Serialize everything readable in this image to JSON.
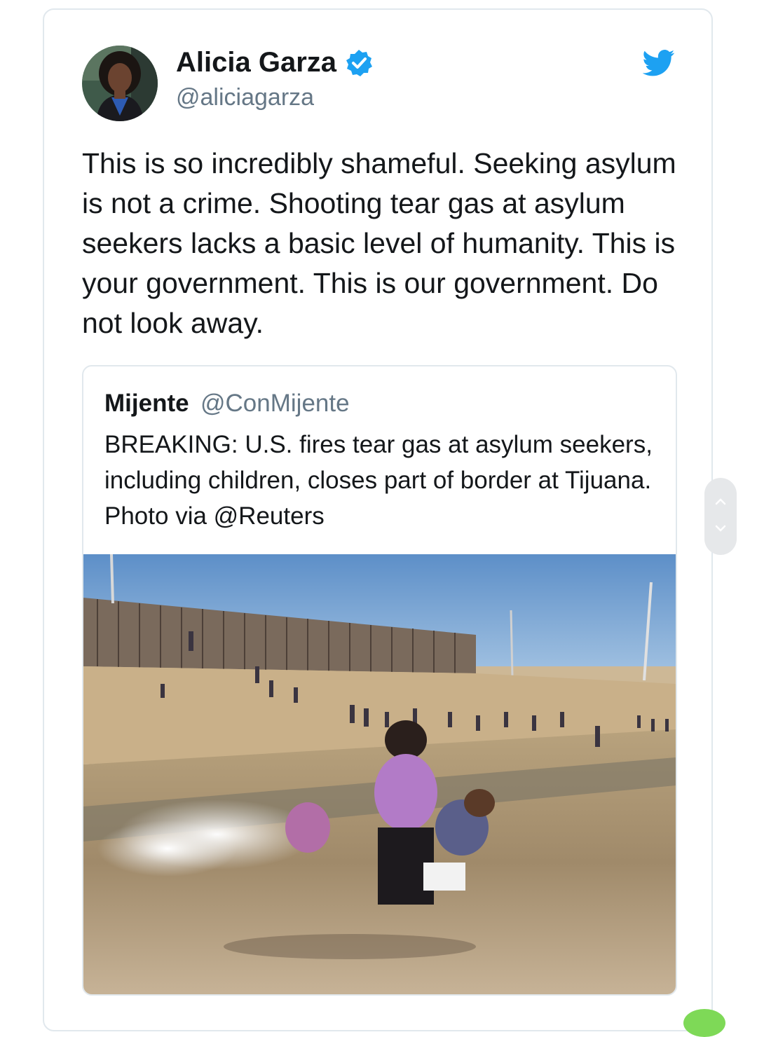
{
  "tweet": {
    "author_name": "Alicia Garza",
    "author_handle": "@aliciagarza",
    "text": "This is so incredibly shameful. Seeking asylum is not a crime. Shooting tear gas at asylum seekers lacks a basic level of humanity. This is your government. This is our government. Do not look away.",
    "verified_icon": "verified-badge-icon",
    "platform_icon": "twitter-bird-icon"
  },
  "quoted_tweet": {
    "author_name": "Mijente",
    "author_handle": "@ConMijente",
    "text": "BREAKING: U.S. fires tear gas at asylum seekers, including children, closes part of border at Tijuana. Photo via @Reuters"
  },
  "colors": {
    "twitter_blue": "#1da1f2",
    "text_primary": "#14171a",
    "text_secondary": "#657786",
    "border": "#e1e8ed"
  }
}
